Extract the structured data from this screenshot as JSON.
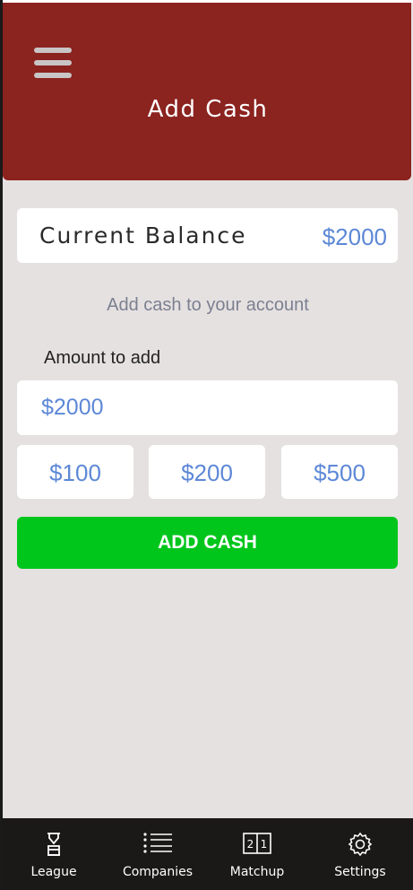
{
  "header": {
    "title": "Add Cash"
  },
  "balance": {
    "label": "Current Balance",
    "value": "$2000"
  },
  "subtitle": "Add cash to your account",
  "amount": {
    "label": "Amount to add",
    "value": "$2000"
  },
  "presets": [
    "$100",
    "$200",
    "$500"
  ],
  "action": {
    "label": "ADD CASH"
  },
  "tabs": [
    {
      "label": "League",
      "icon": "hourglass-icon"
    },
    {
      "label": "Companies",
      "icon": "list-icon"
    },
    {
      "label": "Matchup",
      "icon": "scoreboard-icon"
    },
    {
      "label": "Settings",
      "icon": "gear-icon"
    }
  ],
  "colors": {
    "header": "#8b231f",
    "background": "#e6e1e1",
    "accent_blue": "#5d88d6",
    "button_green": "#00c61c",
    "tabbar": "#1b1818"
  }
}
